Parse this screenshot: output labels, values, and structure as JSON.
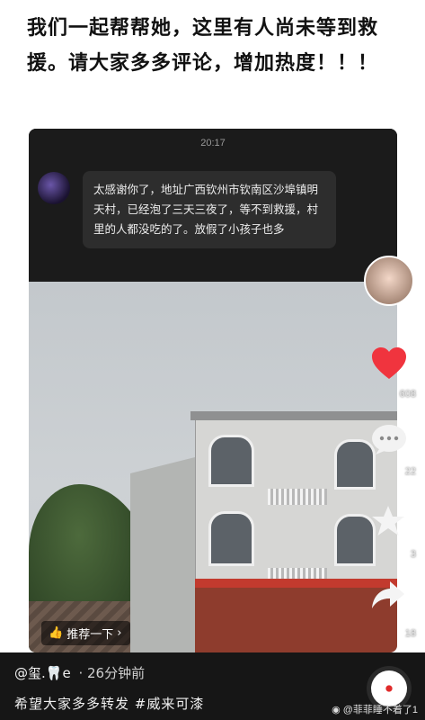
{
  "header": {
    "text": "我们一起帮帮她，这里有人尚未等到救援。请大家多多评论，增加热度！！！"
  },
  "chat": {
    "time": "20:17",
    "message": "太感谢你了，地址广西钦州市钦南区沙埠镇明天村，已经泡了三天三夜了，等不到救援，村里的人都没吃的了。放假了小孩子也多"
  },
  "video": {
    "recommend_label": "推荐一下",
    "like_count": "608",
    "comment_count": "22",
    "favorite_count": "3",
    "share_count": "18"
  },
  "footer": {
    "author": "@玺.🦷e",
    "time_ago": "· 26分钟前",
    "caption": "希望大家多多转发 #威来可漆",
    "watermark": "@菲菲睡不着了1"
  },
  "colors": {
    "like_red": "#f0343e",
    "bar_bg": "#161616",
    "chat_bg": "#1b1b1b"
  }
}
